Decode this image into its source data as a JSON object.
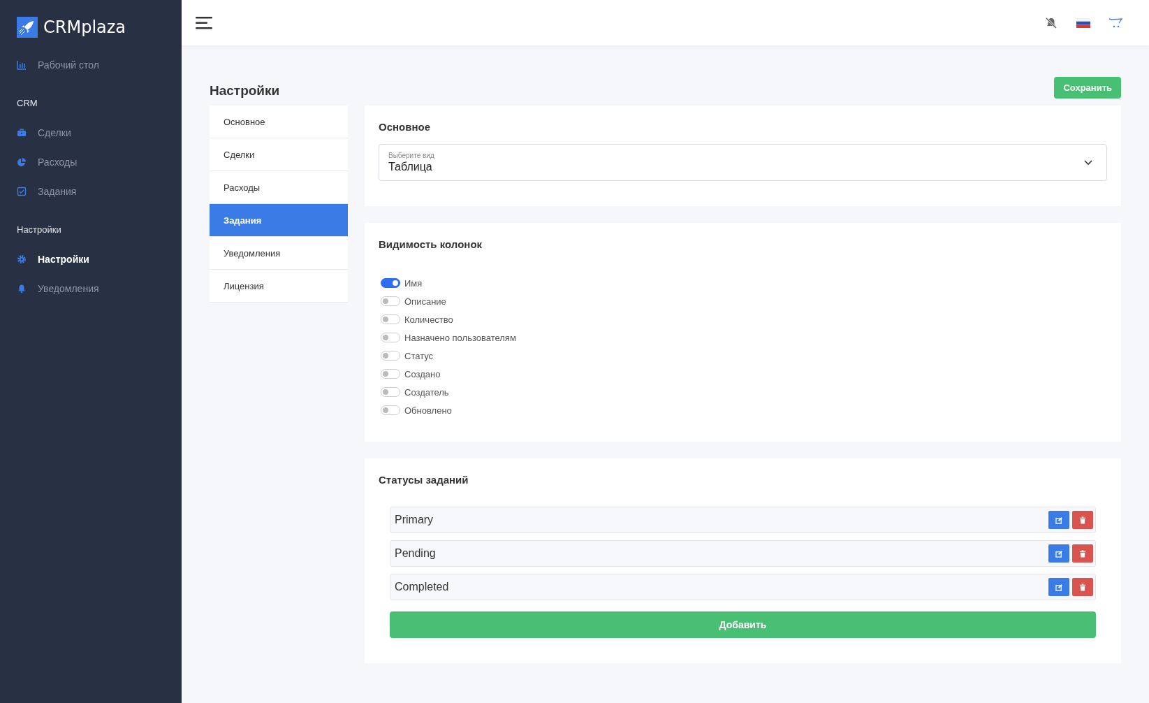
{
  "brand": {
    "name": "CRMplaza"
  },
  "sidebar": {
    "sections": [
      {
        "items": [
          {
            "label": "Рабочий стол",
            "kind": "chart",
            "selected": false
          }
        ]
      },
      {
        "heading": "CRM",
        "items": [
          {
            "label": "Сделки",
            "kind": "briefcase",
            "selected": false
          },
          {
            "label": "Расходы",
            "kind": "pie",
            "selected": false
          },
          {
            "label": "Задания",
            "kind": "checkbox",
            "selected": false
          }
        ]
      },
      {
        "heading": "Настройки",
        "items": [
          {
            "label": "Настройки",
            "kind": "gear",
            "selected": true
          },
          {
            "label": "Уведомления",
            "kind": "bell",
            "selected": false
          }
        ]
      }
    ]
  },
  "page": {
    "title": "Настройки",
    "save_button": "Сохранить"
  },
  "settings_tabs": [
    {
      "label": "Основное",
      "selected": false
    },
    {
      "label": "Сделки",
      "selected": false
    },
    {
      "label": "Расходы",
      "selected": false
    },
    {
      "label": "Задания",
      "selected": true
    },
    {
      "label": "Уведомления",
      "selected": false
    },
    {
      "label": "Лицензия",
      "selected": false
    }
  ],
  "general": {
    "title": "Основное",
    "view_select": {
      "label": "Выберите вид",
      "value": "Таблица"
    }
  },
  "column_visibility": {
    "title": "Видимость колонок",
    "columns": [
      {
        "label": "Имя",
        "on": true
      },
      {
        "label": "Описание",
        "on": false
      },
      {
        "label": "Количество",
        "on": false
      },
      {
        "label": "Назначено пользователям",
        "on": false
      },
      {
        "label": "Статус",
        "on": false
      },
      {
        "label": "Создано",
        "on": false
      },
      {
        "label": "Создатель",
        "on": false
      },
      {
        "label": "Обновлено",
        "on": false
      }
    ]
  },
  "task_statuses": {
    "title": "Статусы заданий",
    "statuses": [
      "Primary",
      "Pending",
      "Completed"
    ],
    "add_button": "Добавить"
  }
}
